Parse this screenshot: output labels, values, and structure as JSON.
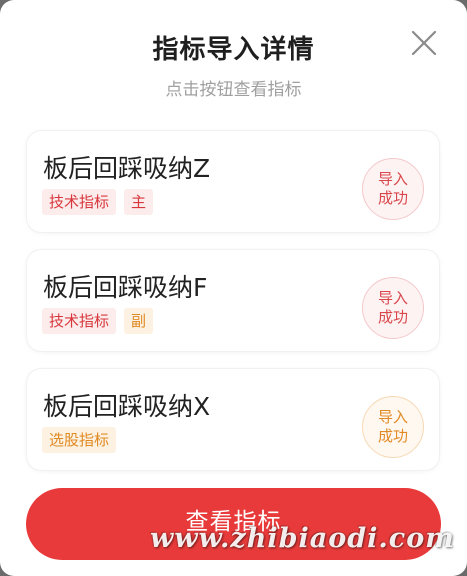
{
  "dialog": {
    "title": "指标导入详情",
    "subtitle": "点击按钮查看指标",
    "close_icon": "close-icon"
  },
  "cards": [
    {
      "name": "板后回踩吸纳Z",
      "tags": [
        "技术指标",
        "主"
      ],
      "tag_colors": [
        "red",
        "red"
      ],
      "status_line1": "导入",
      "status_line2": "成功",
      "status_color": "red"
    },
    {
      "name": "板后回踩吸纳F",
      "tags": [
        "技术指标",
        "副"
      ],
      "tag_colors": [
        "red",
        "orange"
      ],
      "status_line1": "导入",
      "status_line2": "成功",
      "status_color": "red"
    },
    {
      "name": "板后回踩吸纳X",
      "tags": [
        "选股指标"
      ],
      "tag_colors": [
        "orange"
      ],
      "status_line1": "导入",
      "status_line2": "成功",
      "status_color": "orange"
    }
  ],
  "action_button": {
    "label": "查看指标"
  },
  "watermark": "www.zhibiaodi.com",
  "colors": {
    "accent_red": "#e83a3a",
    "tag_red": "#d7373d",
    "tag_orange": "#e08a23"
  }
}
